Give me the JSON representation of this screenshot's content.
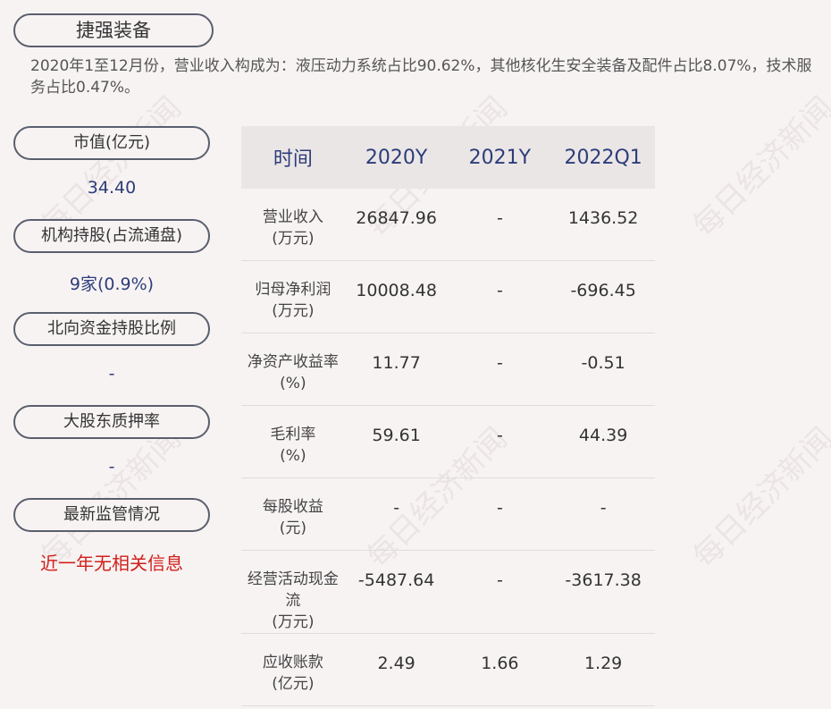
{
  "header": {
    "title": "捷强装备"
  },
  "description": "2020年1至12月份，营业收入构成为：液压动力系统占比90.62%，其他核化生安全装备及配件占比8.07%，技术服务占比0.47%。",
  "sidebar": [
    {
      "label": "市值(亿元)",
      "value": "34.40"
    },
    {
      "label": "机构持股(占流通盘)",
      "value": "9家(0.9%)"
    },
    {
      "label": "北向资金持股比例",
      "value": "-"
    },
    {
      "label": "大股东质押率",
      "value": "-"
    },
    {
      "label": "最新监管情况",
      "value": "近一年无相关信息"
    }
  ],
  "table": {
    "headers": [
      "时间",
      "2020Y",
      "2021Y",
      "2022Q1"
    ],
    "rows": [
      {
        "label": "营业收入",
        "unit": "(万元)",
        "values": [
          "26847.96",
          "-",
          "1436.52"
        ]
      },
      {
        "label": "归母净利润",
        "unit": "(万元)",
        "values": [
          "10008.48",
          "-",
          "-696.45"
        ]
      },
      {
        "label": "净资产收益率",
        "unit": "(%)",
        "values": [
          "11.77",
          "-",
          "-0.51"
        ]
      },
      {
        "label": "毛利率",
        "unit": "(%)",
        "values": [
          "59.61",
          "-",
          "44.39"
        ]
      },
      {
        "label": "每股收益",
        "unit": "(元)",
        "values": [
          "-",
          "-",
          "-"
        ]
      },
      {
        "label": "经营活动现金流",
        "unit": "(万元)",
        "values": [
          "-5487.64",
          "-",
          "-3617.38"
        ]
      },
      {
        "label": "应收账款",
        "unit": "(亿元)",
        "values": [
          "2.49",
          "1.66",
          "1.29"
        ]
      }
    ]
  },
  "watermark": "每日经济新闻",
  "colors": {
    "accent": "#2c3d7a",
    "alert": "#d0201a",
    "header_bg": "#ebe6e6",
    "page_bg": "#f8f3f3"
  }
}
